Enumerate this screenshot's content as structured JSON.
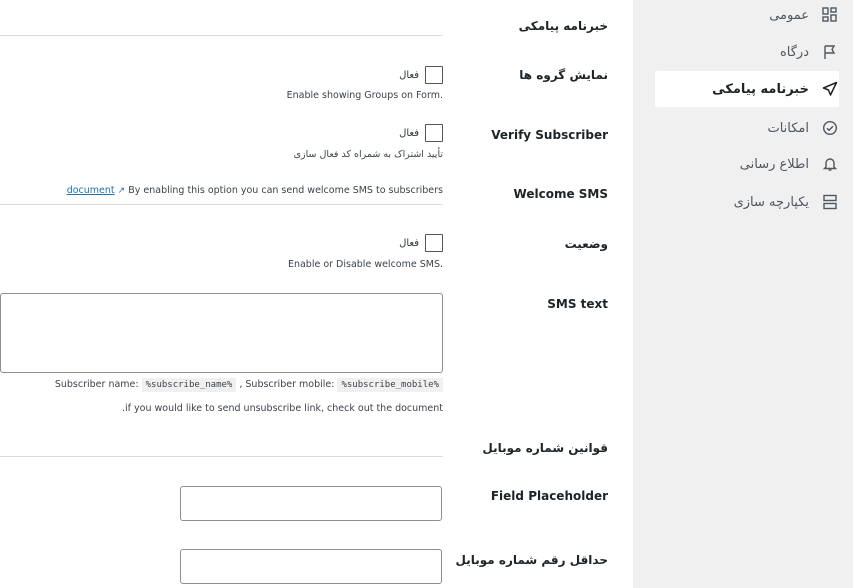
{
  "sidebar": {
    "items": [
      {
        "label": "عمومی",
        "icon": "dashboard-grid-icon"
      },
      {
        "label": "درگاه",
        "icon": "flag-icon"
      },
      {
        "label": "خبرنامه پیامکی",
        "icon": "send-icon",
        "active": true
      },
      {
        "label": "امکانات",
        "icon": "check-circle-icon"
      },
      {
        "label": "اطلاع رسانی",
        "icon": "bell-icon"
      },
      {
        "label": "یکپارچه سازی",
        "icon": "layout-icon"
      }
    ]
  },
  "main": {
    "section_title": "خبرنامه پیامکی",
    "show_groups": {
      "label": "نمایش گروه ها",
      "checkbox_label": "فعال",
      "description": "Enable showing Groups on Form."
    },
    "verify_subscriber": {
      "label": "Verify Subscriber",
      "checkbox_label": "فعال",
      "description": "تأیید اشتراک به شمراه کد فعال سازی"
    },
    "welcome_sms": {
      "label": "Welcome SMS",
      "description_prefix": "By enabling this option you can send welcome SMS to subscribers",
      "link": "document"
    },
    "status": {
      "label": "وضعیت",
      "checkbox_label": "فعال",
      "description": "Enable or Disable welcome SMS."
    },
    "sms_text": {
      "label": "SMS text",
      "value": "",
      "help_name_label": "Subscriber name:",
      "help_name_code": "%subscribe_name%",
      "help_sep": ", Subscriber mobile:",
      "help_mobile_code": "%subscribe_mobile%",
      "help_unsubscribe": "if you would like to send unsubscribe link, check out the document."
    },
    "mobile_rules_title": "قوانین شماره موبایل",
    "field_placeholder": {
      "label": "Field Placeholder",
      "value": ""
    },
    "min_mobile_digits": {
      "label": "حداقل رقم شماره موبایل",
      "value": ""
    }
  }
}
